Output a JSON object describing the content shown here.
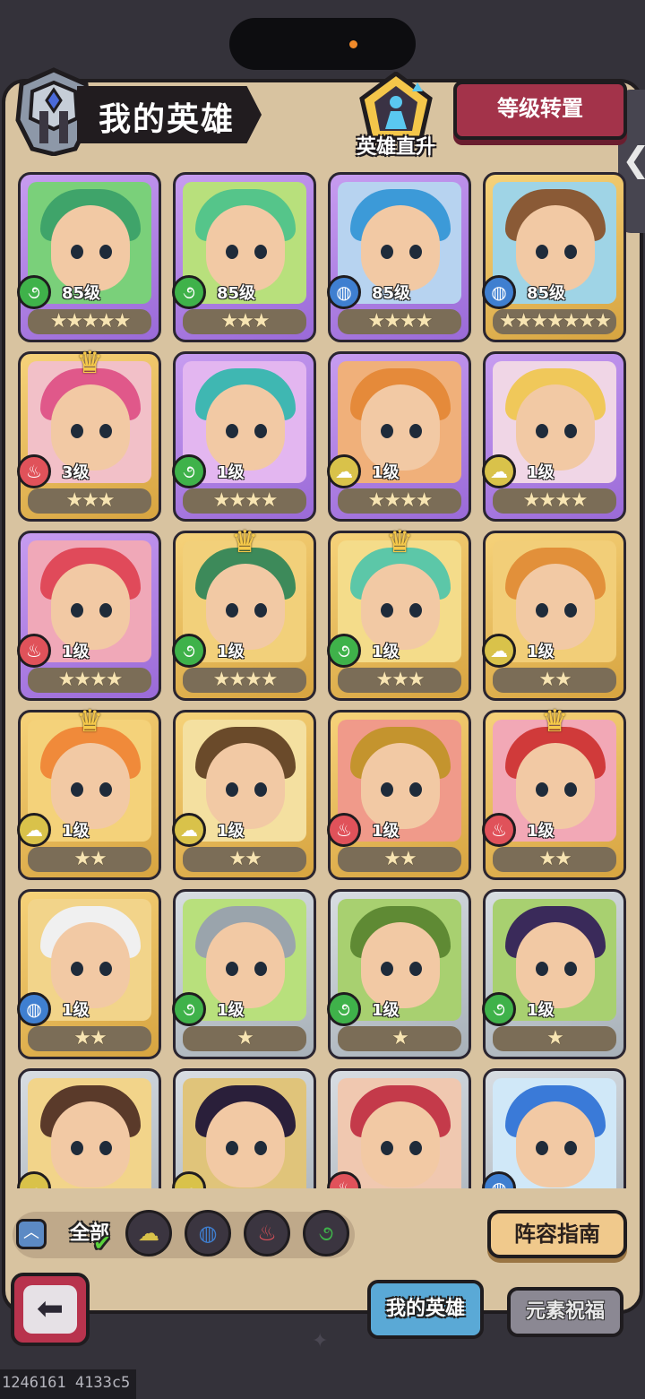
{
  "header": {
    "title": "我的英雄",
    "ascend_label": "英雄直升",
    "level_reset_label": "等级转置",
    "side_tab_icon": "chevron-left-icon"
  },
  "colors": {
    "wood": "#3fb24a",
    "water": "#3f7fd0",
    "fire": "#e0525a",
    "earth": "#d9c24a",
    "rarity_purple": "#b67be0",
    "rarity_gold": "#e3b24a",
    "rarity_silver": "#b9c2c9"
  },
  "heroes": [
    {
      "level": "85级",
      "stars": "★★★★★",
      "element": "wood",
      "rarity": "purple",
      "crown": false,
      "hair": "#3fa46a",
      "bg": "#7ad07a"
    },
    {
      "level": "85级",
      "stars": "★★★",
      "element": "wood",
      "rarity": "purple",
      "crown": false,
      "hair": "#55c58a",
      "bg": "#b8e07c"
    },
    {
      "level": "85级",
      "stars": "★★★★",
      "element": "water",
      "rarity": "purple",
      "crown": false,
      "hair": "#3c9ad8",
      "bg": "#b7d3f0"
    },
    {
      "level": "85级",
      "stars": "★★★★★★★",
      "element": "water",
      "rarity": "gold",
      "crown": false,
      "hair": "#8a5a36",
      "bg": "#9fd4e6"
    },
    {
      "level": "3级",
      "stars": "★★★",
      "element": "fire",
      "rarity": "gold",
      "crown": true,
      "hair": "#e0588a",
      "bg": "#f2c0c8"
    },
    {
      "level": "1级",
      "stars": "★★★★",
      "element": "wood",
      "rarity": "purple",
      "crown": false,
      "hair": "#3fb7b2",
      "bg": "#e3b6f0"
    },
    {
      "level": "1级",
      "stars": "★★★★",
      "element": "earth",
      "rarity": "purple",
      "crown": false,
      "hair": "#e58a3a",
      "bg": "#f0b07a"
    },
    {
      "level": "1级",
      "stars": "★★★★",
      "element": "earth",
      "rarity": "purple",
      "crown": false,
      "hair": "#f0c85a",
      "bg": "#f0d6e6"
    },
    {
      "level": "1级",
      "stars": "★★★★",
      "element": "fire",
      "rarity": "purple",
      "crown": false,
      "hair": "#e04a5a",
      "bg": "#f0a8b8"
    },
    {
      "level": "1级",
      "stars": "★★★★",
      "element": "wood",
      "rarity": "gold",
      "crown": true,
      "hair": "#3d8a5a",
      "bg": "#f2d07a"
    },
    {
      "level": "1级",
      "stars": "★★★",
      "element": "wood",
      "rarity": "gold",
      "crown": true,
      "hair": "#5cc7a8",
      "bg": "#f4dc8a"
    },
    {
      "level": "1级",
      "stars": "★★",
      "element": "earth",
      "rarity": "gold",
      "crown": false,
      "hair": "#e2903a",
      "bg": "#f2ce78"
    },
    {
      "level": "1级",
      "stars": "★★",
      "element": "earth",
      "rarity": "gold",
      "crown": true,
      "hair": "#f08a3a",
      "bg": "#f4d27a"
    },
    {
      "level": "1级",
      "stars": "★★",
      "element": "earth",
      "rarity": "gold",
      "crown": false,
      "hair": "#6a4a2a",
      "bg": "#f4e0a0"
    },
    {
      "level": "1级",
      "stars": "★★",
      "element": "fire",
      "rarity": "gold",
      "crown": false,
      "hair": "#c4942e",
      "bg": "#f09a8a"
    },
    {
      "level": "1级",
      "stars": "★★",
      "element": "fire",
      "rarity": "gold",
      "crown": true,
      "hair": "#d03a3a",
      "bg": "#f2a8b6"
    },
    {
      "level": "1级",
      "stars": "★★",
      "element": "water",
      "rarity": "gold",
      "crown": false,
      "hair": "#f0f0f0",
      "bg": "#f2d48a"
    },
    {
      "level": "1级",
      "stars": "★",
      "element": "wood",
      "rarity": "silver",
      "crown": false,
      "hair": "#9aa4ac",
      "bg": "#b8e07c"
    },
    {
      "level": "1级",
      "stars": "★",
      "element": "wood",
      "rarity": "silver",
      "crown": false,
      "hair": "#5f8a34",
      "bg": "#a8d070"
    },
    {
      "level": "1级",
      "stars": "★",
      "element": "wood",
      "rarity": "silver",
      "crown": false,
      "hair": "#3a2a5a",
      "bg": "#a8d070"
    },
    {
      "level": "",
      "stars": "",
      "element": "earth",
      "rarity": "silver",
      "crown": false,
      "hair": "#5a3a2a",
      "bg": "#f2d48a"
    },
    {
      "level": "",
      "stars": "",
      "element": "earth",
      "rarity": "silver",
      "crown": false,
      "hair": "#2a1f3a",
      "bg": "#e0c47a"
    },
    {
      "level": "",
      "stars": "",
      "element": "fire",
      "rarity": "silver",
      "crown": false,
      "hair": "#c43a4a",
      "bg": "#f0c8b0"
    },
    {
      "level": "",
      "stars": "",
      "element": "water",
      "rarity": "silver",
      "crown": false,
      "hair": "#3a7ad8",
      "bg": "#d0e8f8"
    }
  ],
  "filters": {
    "collapse_icon": "chevron-up-icon",
    "all_label": "全部",
    "elements": [
      "earth",
      "water",
      "fire",
      "wood"
    ]
  },
  "guide_label": "阵容指南",
  "bottom_tabs": {
    "my_heroes": "我的英雄",
    "element_blessing": "元素祝福"
  },
  "debug_text": "1246161 4133c5"
}
